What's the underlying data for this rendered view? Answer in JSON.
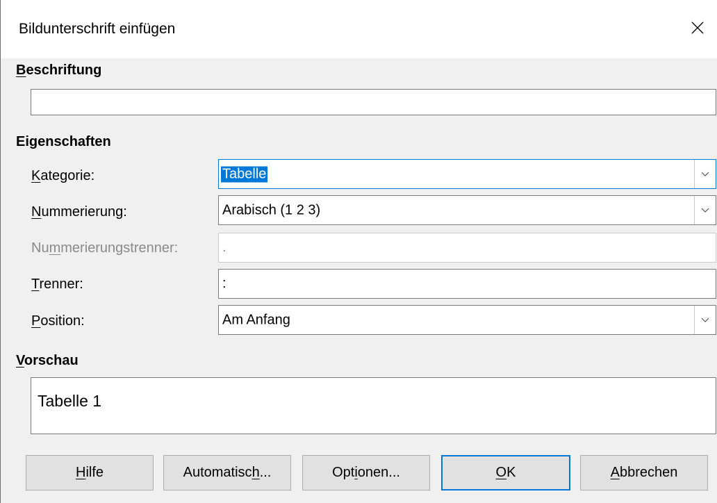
{
  "window": {
    "title": "Bildunterschrift einfügen"
  },
  "caption": {
    "heading_underlined": "B",
    "heading_rest": "eschriftung",
    "value": ""
  },
  "properties": {
    "heading": "Eigenschaften",
    "category": {
      "label_underlined": "K",
      "label_rest": "ategorie:",
      "value": "Tabelle"
    },
    "numbering": {
      "label_underlined": "N",
      "label_rest": "ummerierung:",
      "value": "Arabisch (1 2 3)"
    },
    "numbering_separator": {
      "label_pre": "Nu",
      "label_underlined": "m",
      "label_rest": "merierungstrenner:",
      "value": "."
    },
    "separator": {
      "label_underlined": "T",
      "label_rest": "renner:",
      "value": ":"
    },
    "position": {
      "label_underlined": "P",
      "label_rest": "osition:",
      "value": "Am Anfang"
    }
  },
  "preview": {
    "heading_underlined": "V",
    "heading_rest": "orschau",
    "text": "Tabelle 1"
  },
  "buttons": {
    "help": {
      "pre": "",
      "ul": "H",
      "post": "ilfe"
    },
    "auto": {
      "pre": "Automatisc",
      "ul": "h",
      "post": "..."
    },
    "options": {
      "pre": "Opt",
      "ul": "i",
      "post": "onen..."
    },
    "ok": {
      "pre": "",
      "ul": "O",
      "post": "K"
    },
    "cancel": {
      "pre": "",
      "ul": "A",
      "post": "bbrechen"
    }
  },
  "colors": {
    "accent": "#0078d7",
    "dialog_bg": "#f0f0f0"
  }
}
